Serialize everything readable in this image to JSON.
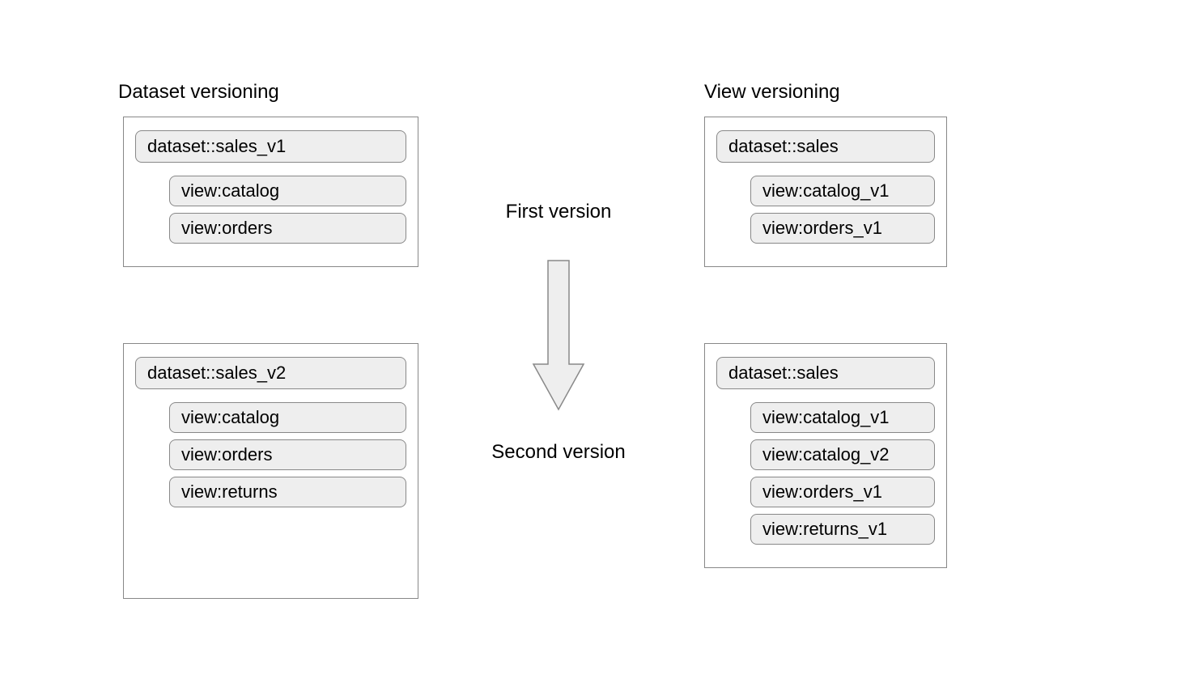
{
  "left": {
    "title": "Dataset versioning",
    "box1": {
      "dataset": "dataset::sales_v1",
      "views": [
        "view:catalog",
        "view:orders"
      ]
    },
    "box2": {
      "dataset": "dataset::sales_v2",
      "views": [
        "view:catalog",
        "view:orders",
        "view:returns"
      ]
    }
  },
  "right": {
    "title": "View versioning",
    "box1": {
      "dataset": "dataset::sales",
      "views": [
        "view:catalog_v1",
        "view:orders_v1"
      ]
    },
    "box2": {
      "dataset": "dataset::sales",
      "views": [
        "view:catalog_v1",
        "view:catalog_v2",
        "view:orders_v1",
        "view:returns_v1"
      ]
    }
  },
  "center": {
    "first": "First version",
    "second": "Second version"
  }
}
